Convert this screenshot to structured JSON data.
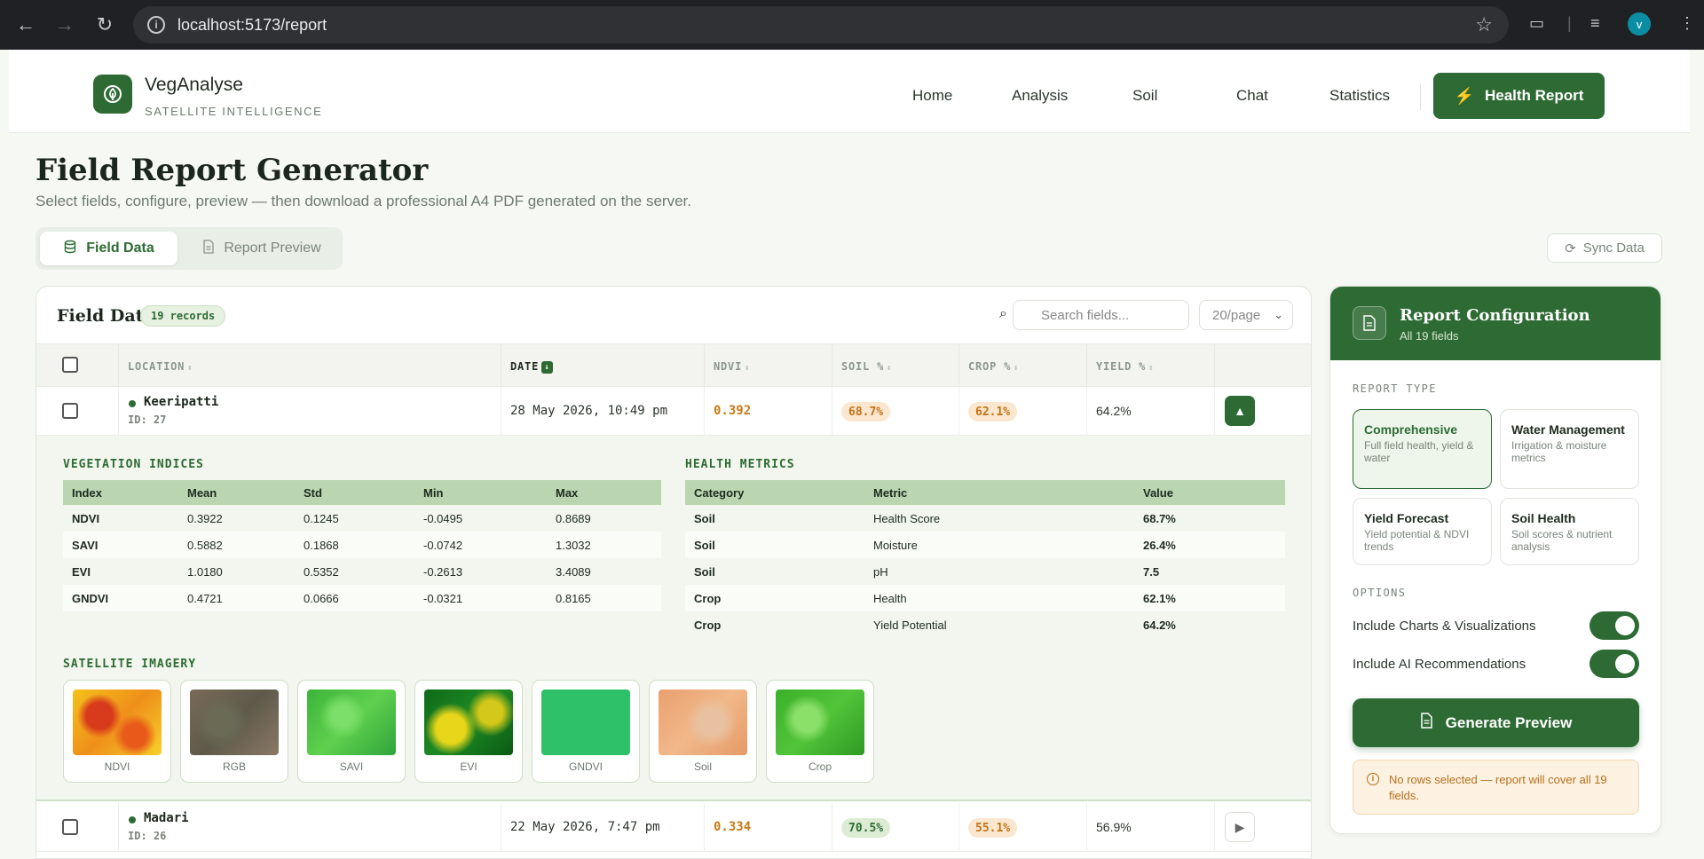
{
  "browser": {
    "url": "localhost:5173/report",
    "avatar_letter": "v"
  },
  "header": {
    "brand": "VegAnalyse",
    "brand_sub": "SATELLITE INTELLIGENCE",
    "nav": [
      "Home",
      "Analysis",
      "Soil",
      "Chat",
      "Statistics"
    ],
    "cta": "Health Report"
  },
  "page": {
    "title": "Field Report Generator",
    "subtitle": "Select fields, configure, preview — then download a professional A4 PDF generated on the server.",
    "tabs": [
      "Field Data",
      "Report Preview"
    ],
    "sync": "Sync Data"
  },
  "table": {
    "title": "Field Data",
    "records": "19 records",
    "search_placeholder": "Search fields...",
    "per_page": "20/page",
    "columns": [
      "LOCATION",
      "DATE",
      "NDVI",
      "SOIL %",
      "CROP %",
      "YIELD %"
    ],
    "rows": [
      {
        "name": "Keeripatti",
        "id": "ID: 27",
        "date": "28 May 2026, 10:49 pm",
        "ndvi": "0.392",
        "soil": "68.7%",
        "crop": "62.1%",
        "yield": "64.2%"
      },
      {
        "name": "Madari",
        "id": "ID: 26",
        "date": "22 May 2026, 7:47 pm",
        "ndvi": "0.334",
        "soil": "70.5%",
        "crop": "55.1%",
        "yield": "56.9%"
      }
    ]
  },
  "detail": {
    "veg_title": "VEGETATION INDICES",
    "veg_headers": [
      "Index",
      "Mean",
      "Std",
      "Min",
      "Max"
    ],
    "veg_rows": [
      [
        "NDVI",
        "0.3922",
        "0.1245",
        "-0.0495",
        "0.8689"
      ],
      [
        "SAVI",
        "0.5882",
        "0.1868",
        "-0.0742",
        "1.3032"
      ],
      [
        "EVI",
        "1.0180",
        "0.5352",
        "-0.2613",
        "3.4089"
      ],
      [
        "GNDVI",
        "0.4721",
        "0.0666",
        "-0.0321",
        "0.8165"
      ]
    ],
    "health_title": "HEALTH METRICS",
    "health_headers": [
      "Category",
      "Metric",
      "Value"
    ],
    "health_rows": [
      [
        "Soil",
        "Health Score",
        "68.7%"
      ],
      [
        "Soil",
        "Moisture",
        "26.4%"
      ],
      [
        "Soil",
        "pH",
        "7.5"
      ],
      [
        "Crop",
        "Health",
        "62.1%"
      ],
      [
        "Crop",
        "Yield Potential",
        "64.2%"
      ]
    ],
    "imagery_title": "SATELLITE IMAGERY",
    "imagery": [
      "NDVI",
      "RGB",
      "SAVI",
      "EVI",
      "GNDVI",
      "Soil",
      "Crop"
    ]
  },
  "config": {
    "title": "Report Configuration",
    "subtitle": "All 19 fields",
    "report_type_label": "REPORT TYPE",
    "types": [
      {
        "title": "Comprehensive",
        "desc": "Full field health, yield & water"
      },
      {
        "title": "Water Management",
        "desc": "Irrigation & moisture metrics"
      },
      {
        "title": "Yield Forecast",
        "desc": "Yield potential & NDVI trends"
      },
      {
        "title": "Soil Health",
        "desc": "Soil scores & nutrient analysis"
      }
    ],
    "options_label": "OPTIONS",
    "options": [
      "Include Charts & Visualizations",
      "Include AI Recommendations"
    ],
    "generate": "Generate Preview",
    "warning": "No rows selected — report will cover all 19 fields."
  },
  "colors": {
    "accent": "#2e6b34",
    "warning": "#b5701d",
    "ndvi": "#c77b17"
  }
}
